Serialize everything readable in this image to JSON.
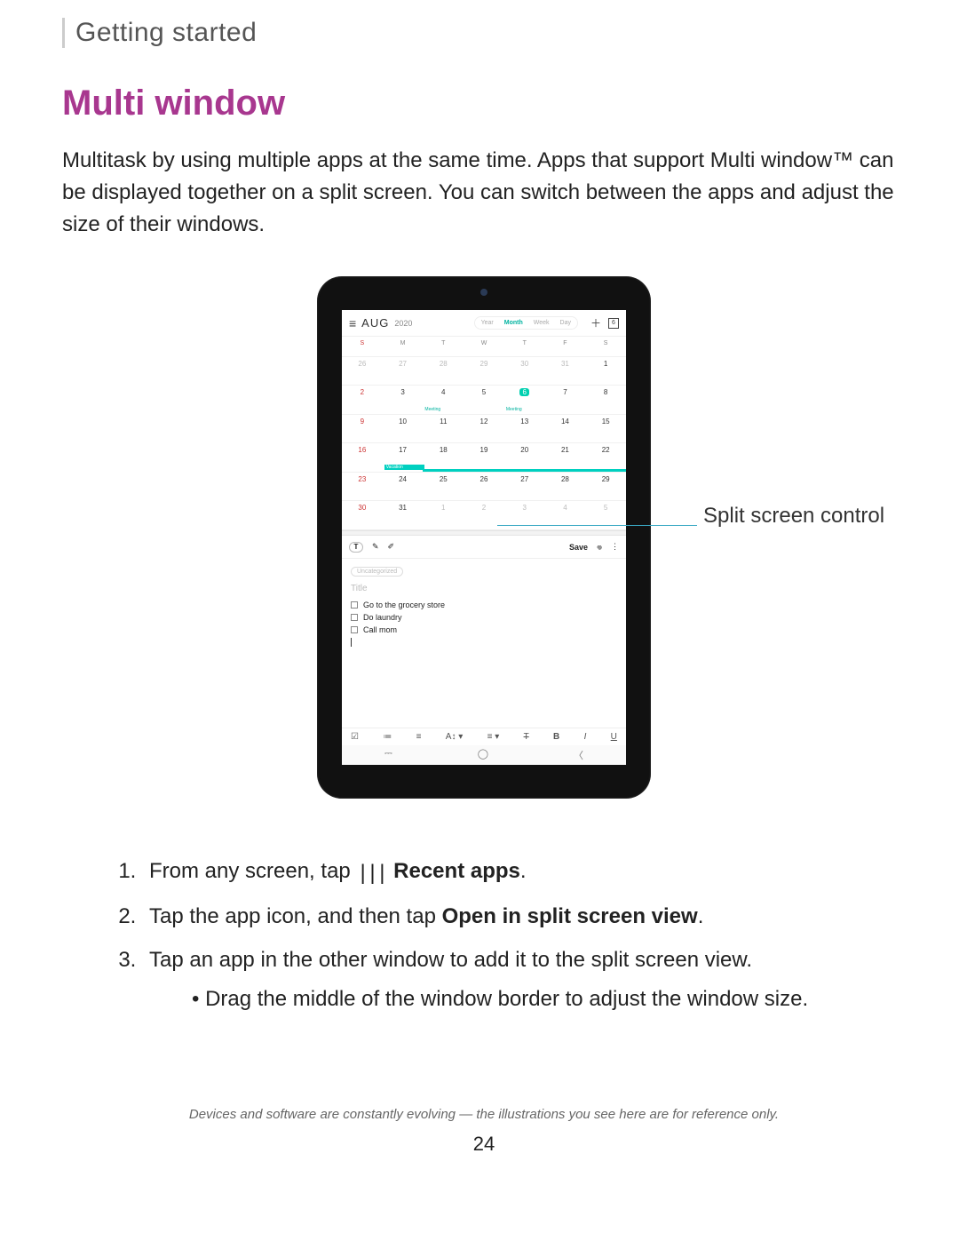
{
  "header": {
    "section": "Getting started"
  },
  "title": "Multi window",
  "intro": "Multitask by using multiple apps at the same time. Apps that support Multi window™ can be displayed together on a split screen. You can switch between the apps and adjust the size of their windows.",
  "callout": "Split screen control",
  "device": {
    "calendar": {
      "month": "AUG",
      "year": "2020",
      "views": [
        "Year",
        "Month",
        "Week",
        "Day"
      ],
      "active_view": "Month",
      "today_num": "6",
      "days_head": [
        "S",
        "M",
        "T",
        "W",
        "T",
        "F",
        "S"
      ],
      "weeks": [
        [
          "26",
          "27",
          "28",
          "29",
          "30",
          "31",
          "1"
        ],
        [
          "2",
          "3",
          "4",
          "5",
          "6",
          "7",
          "8"
        ],
        [
          "9",
          "10",
          "11",
          "12",
          "13",
          "14",
          "15"
        ],
        [
          "16",
          "17",
          "18",
          "19",
          "20",
          "21",
          "22"
        ],
        [
          "23",
          "24",
          "25",
          "26",
          "27",
          "28",
          "29"
        ],
        [
          "30",
          "31",
          "1",
          "2",
          "3",
          "4",
          "5"
        ]
      ],
      "event_label": "Meeting",
      "vacation_label": "Vacation"
    },
    "notes": {
      "save": "Save",
      "chip": "Uncategorized",
      "title_placeholder": "Title",
      "todos": [
        "Go to the grocery store",
        "Do laundry",
        "Call mom"
      ],
      "toolbar": [
        "☑",
        "≔",
        "≡",
        "A↕ ▾",
        "≡ ▾",
        "T",
        "B",
        "I",
        "U"
      ]
    }
  },
  "steps": {
    "s1a": "From any screen, tap",
    "s1b": "Recent apps",
    "s2a": "Tap the app icon, and then tap ",
    "s2b": "Open in split screen view",
    "s3": "Tap an app in the other window to add it to the split screen view.",
    "s3a": "Drag the middle of the window border to adjust the window size."
  },
  "disclaimer": "Devices and software are constantly evolving — the illustrations you see here are for reference only.",
  "page": "24"
}
